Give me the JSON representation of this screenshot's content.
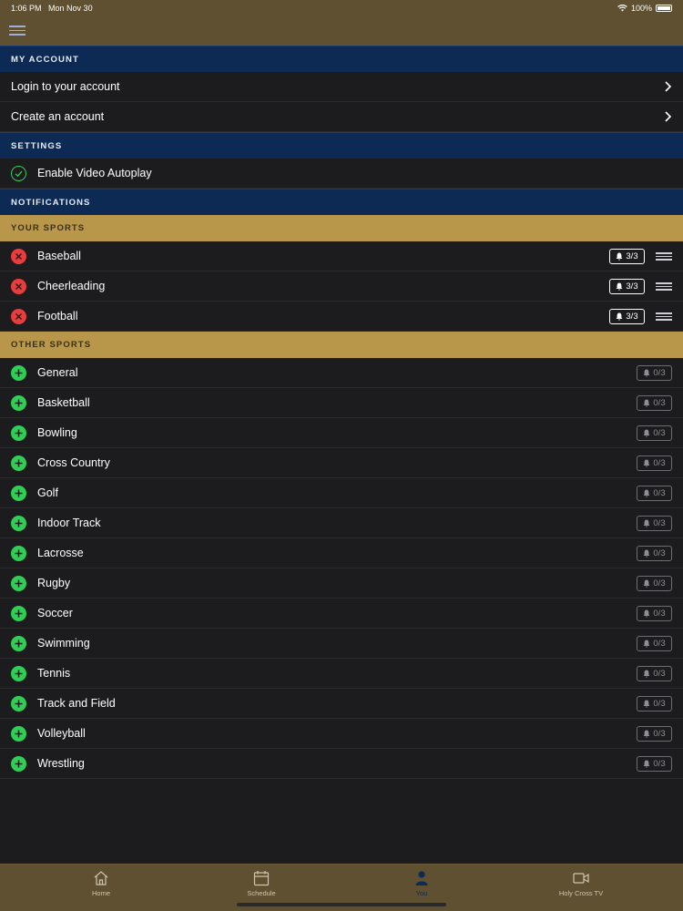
{
  "status": {
    "time": "1:06 PM",
    "date": "Mon Nov 30",
    "battery": "100%"
  },
  "menu_icon": "hamburger-icon",
  "my_account": {
    "header": "MY ACCOUNT",
    "items": [
      {
        "label": "Login to your account"
      },
      {
        "label": "Create an account"
      }
    ]
  },
  "settings": {
    "header": "SETTINGS",
    "autoplay_label": "Enable Video Autoplay",
    "autoplay_enabled": true
  },
  "notifications": {
    "header": "NOTIFICATIONS"
  },
  "your_sports": {
    "header": "YOUR SPORTS",
    "items": [
      {
        "name": "Baseball",
        "alerts": "3/3"
      },
      {
        "name": "Cheerleading",
        "alerts": "3/3"
      },
      {
        "name": "Football",
        "alerts": "3/3"
      }
    ]
  },
  "other_sports": {
    "header": "OTHER SPORTS",
    "items": [
      {
        "name": "General",
        "alerts": "0/3"
      },
      {
        "name": "Basketball",
        "alerts": "0/3"
      },
      {
        "name": "Bowling",
        "alerts": "0/3"
      },
      {
        "name": "Cross Country",
        "alerts": "0/3"
      },
      {
        "name": "Golf",
        "alerts": "0/3"
      },
      {
        "name": "Indoor Track",
        "alerts": "0/3"
      },
      {
        "name": "Lacrosse",
        "alerts": "0/3"
      },
      {
        "name": "Rugby",
        "alerts": "0/3"
      },
      {
        "name": "Soccer",
        "alerts": "0/3"
      },
      {
        "name": "Swimming",
        "alerts": "0/3"
      },
      {
        "name": "Tennis",
        "alerts": "0/3"
      },
      {
        "name": "Track and Field",
        "alerts": "0/3"
      },
      {
        "name": "Volleyball",
        "alerts": "0/3"
      },
      {
        "name": "Wrestling",
        "alerts": "0/3"
      }
    ]
  },
  "tabs": [
    {
      "label": "Home",
      "icon": "home-icon"
    },
    {
      "label": "Schedule",
      "icon": "calendar-icon"
    },
    {
      "label": "You",
      "icon": "person-icon",
      "active": true
    },
    {
      "label": "Holy Cross TV",
      "icon": "video-camera-icon"
    }
  ],
  "colors": {
    "header_bar": "#5e5030",
    "section_navy": "#0d2a55",
    "section_gold": "#b8974a",
    "remove_red": "#e93c3c",
    "add_green": "#2fcf56",
    "background": "#1c1c1e"
  }
}
